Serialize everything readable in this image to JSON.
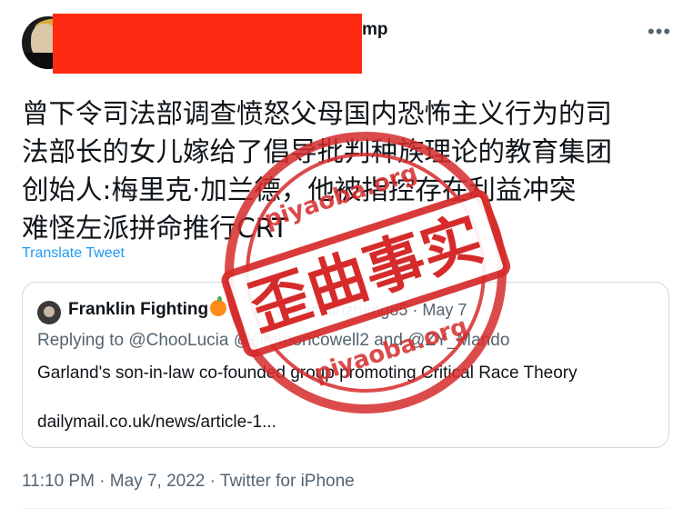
{
  "author": {
    "handle_fragment": "mp"
  },
  "menu": {
    "more_glyph": "•••"
  },
  "tweet": {
    "text_lines": [
      "曾下令司法部调查愤怒父母国内恐怖主义行为的司",
      "法部长的女儿嫁给了倡导批判种族理论的教育集团",
      "创始人:梅里克·加兰德，他被指控存在利益冲突",
      "难怪左派拼命推行CRT"
    ],
    "translate_label": "Translate Tweet"
  },
  "quote": {
    "name": "Franklin Fighting",
    "handle_date": "@franklinzhang85 · May 7",
    "replying_prefix": "Replying to",
    "replying_mentions": "@ChooLucia @simmoncowell2 and @ZY_Mando",
    "text": "Garland's son-in-law co-founded group promoting Critical Race Theory",
    "link": "dailymail.co.uk/news/article-1..."
  },
  "meta": {
    "line": "11:10 PM · May 7, 2022 · Twitter for iPhone"
  },
  "stamp": {
    "label": "歪曲事实",
    "watermark": "piyaoba.org",
    "color": "#d62b2b"
  }
}
